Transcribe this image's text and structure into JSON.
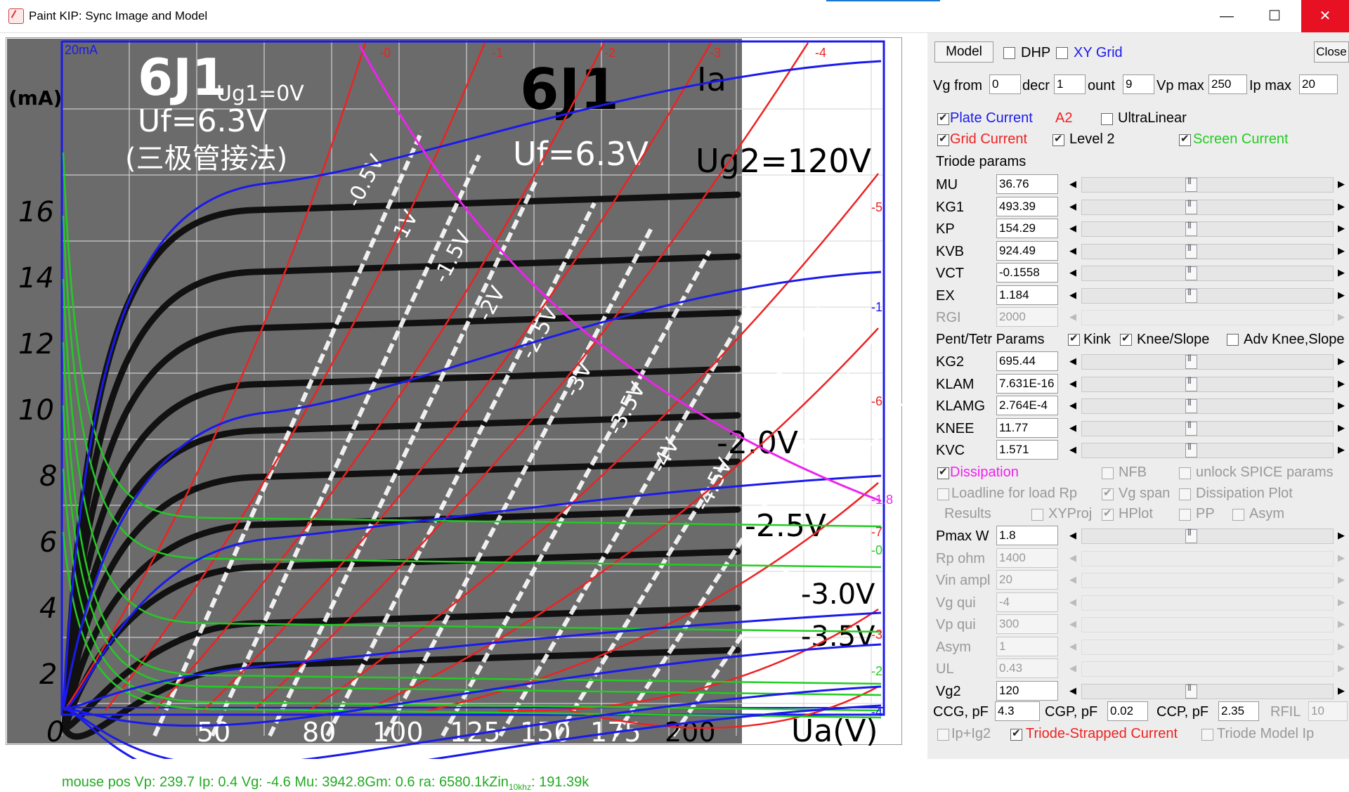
{
  "window": {
    "title": "Paint KIP: Sync Image and Model",
    "minimize_glyph": "—",
    "maximize_glyph": "☐",
    "close_glyph": "✕"
  },
  "plot": {
    "scale_label": "20mA",
    "vg_curve_labels_top": [
      "-0",
      "-1",
      "-2",
      "-3",
      "-4"
    ],
    "vg_curve_labels_right": [
      "-5",
      "-6",
      "-1",
      "-1.8",
      "-7",
      "-0",
      "-3",
      "-2",
      "-4"
    ],
    "image_text": {
      "tube_left": "6J1",
      "tube_right": "6J1",
      "ug1_0v": "Ug1=0V",
      "uf_left": "Uf=6.3V",
      "connection": "(三极管接法)",
      "uf_right": "Uf=6.3V",
      "ug2": "Ug2=120V",
      "ia_label": "Ia",
      "ia_units": "(mA)",
      "ug1_0v_b": "Ug1=0V",
      "grid_labels": [
        "-0.5V",
        "-1V",
        "-1.5V",
        "-2V",
        "-2.5V",
        "-3V",
        "-3.5V",
        "-4V",
        "-4.5V"
      ],
      "right_labels": [
        "-2.0V",
        "-2.5V",
        "-3.0V",
        "-3.5V"
      ],
      "y_ticks": [
        "16",
        "14",
        "12",
        "10",
        "8",
        "6",
        "4",
        "2",
        "0"
      ],
      "x_ticks": [
        "50",
        "80",
        "100",
        "125",
        "150",
        "175",
        "200"
      ],
      "x_axis": "Ua(V)"
    },
    "mouse_pos": "mouse pos Vp: 239.7  Ip: 0.4        Vg: -4.6      Mu: 3942.8Gm: 0.6        ra: 6580.1kZin",
    "mouse_sub": "10khz",
    "mouse_tail": ": 191.39k",
    "colors": {
      "plate": "#1a1aee",
      "grid": "#ee2222",
      "screen": "#22cc22",
      "dissipation": "#ee22ee"
    }
  },
  "panel": {
    "model_button": "Model",
    "dhp": "DHP",
    "xy_grid": "XY Grid",
    "close_button": "Close",
    "vg_from_label": "Vg from",
    "vg_from": "0",
    "decr_label": "decr",
    "decr": "1",
    "count_label": "ount",
    "count": "9",
    "vp_max_label": "Vp max",
    "vp_max": "250",
    "ip_max_label": "Ip max",
    "ip_max": "20",
    "plate_current": "Plate Current",
    "a2": "A2",
    "ultralinear": "UltraLinear",
    "grid_current": "Grid Current",
    "level2": "Level 2",
    "screen_current": "Screen Current",
    "triode_params": "Triode params",
    "triode": [
      {
        "label": "MU",
        "value": "36.76"
      },
      {
        "label": "KG1",
        "value": "493.39"
      },
      {
        "label": "KP",
        "value": "154.29"
      },
      {
        "label": "KVB",
        "value": "924.49"
      },
      {
        "label": "VCT",
        "value": "-0.1558"
      },
      {
        "label": "EX",
        "value": "1.184"
      },
      {
        "label": "RGI",
        "value": "2000"
      }
    ],
    "pent_params": "Pent/Tetr Params",
    "kink": "Kink",
    "knee_slope": "Knee/Slope",
    "adv_knee": "Adv Knee,Slope",
    "pent": [
      {
        "label": "KG2",
        "value": "695.44"
      },
      {
        "label": "KLAM",
        "value": "7.631E-16"
      },
      {
        "label": "KLAMG",
        "value": "2.764E-4"
      },
      {
        "label": "KNEE",
        "value": "11.77"
      },
      {
        "label": "KVC",
        "value": "1.571"
      }
    ],
    "dissipation": "Dissipation",
    "nfb": "NFB",
    "unlock_spice": "unlock SPICE params",
    "loadline": "Loadline for load Rp",
    "vg_span": "Vg span",
    "dissipation_plot": "Dissipation Plot",
    "results": "Results",
    "xyproj": "XYProj",
    "hplot": "HPlot",
    "pp": "PP",
    "asym_cb": "Asym",
    "lower": [
      {
        "label": "Pmax W",
        "value": "1.8"
      },
      {
        "label": "Rp ohm",
        "value": "1400"
      },
      {
        "label": "Vin ampl",
        "value": "20"
      },
      {
        "label": "Vg qui",
        "value": "-4"
      },
      {
        "label": "Vp qui",
        "value": "300"
      },
      {
        "label": "Asym",
        "value": "1"
      },
      {
        "label": "UL",
        "value": "0.43"
      },
      {
        "label": "Vg2",
        "value": "120"
      }
    ],
    "ccg_label": "CCG, pF",
    "ccg": "4.3",
    "cgp_label": "CGP, pF",
    "cgp": "0.02",
    "ccp_label": "CCP, pF",
    "ccp": "2.35",
    "rfil_label": "RFIL",
    "rfil": "10",
    "ip_ig2": "Ip+Ig2",
    "triode_strapped": "Triode-Strapped Current",
    "triode_model_ip": "Triode Model Ip"
  }
}
